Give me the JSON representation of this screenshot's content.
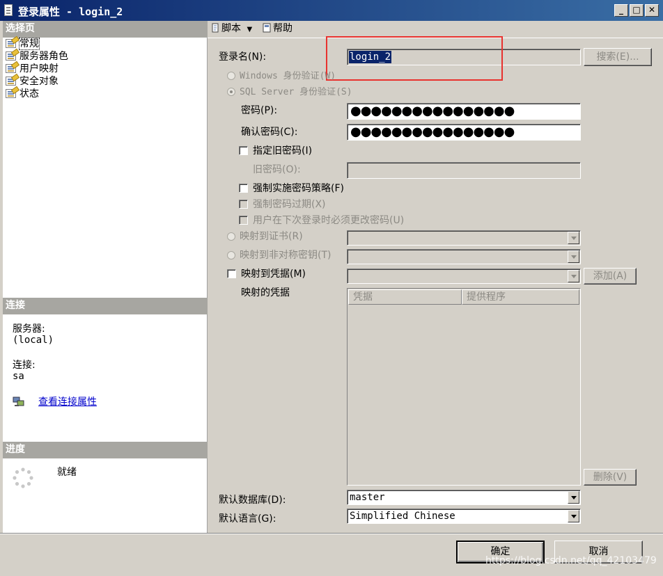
{
  "window": {
    "title": "登录属性 - login_2"
  },
  "left": {
    "section_select_page": "选择页",
    "nav_items": [
      {
        "label": "常规"
      },
      {
        "label": "服务器角色"
      },
      {
        "label": "用户映射"
      },
      {
        "label": "安全对象"
      },
      {
        "label": "状态"
      }
    ],
    "section_connection": "连接",
    "server_label": "服务器:",
    "server_value": "(local)",
    "connection_label": "连接:",
    "connection_value": "sa",
    "view_connection_link": "查看连接属性",
    "section_progress": "进度",
    "progress_status": "就绪"
  },
  "toolbar": {
    "script_label": "脚本",
    "help_label": "帮助"
  },
  "form": {
    "login_name_label": "登录名(N):",
    "login_name_value": "login_2",
    "search_button": "搜索(E)...",
    "windows_auth": "Windows 身份验证(W)",
    "sql_auth": "SQL Server 身份验证(S)",
    "password_label": "密码(P):",
    "password_mask": "●●●●●●●●●●●●●●●●",
    "confirm_label": "确认密码(C):",
    "confirm_mask": "●●●●●●●●●●●●●●●●",
    "specify_old_password": "指定旧密码(I)",
    "old_password_label": "旧密码(O):",
    "enforce_policy": "强制实施密码策略(F)",
    "enforce_expiration": "强制密码过期(X)",
    "must_change": "用户在下次登录时必须更改密码(U)",
    "map_certificate": "映射到证书(R)",
    "map_asym_key": "映射到非对称密钥(T)",
    "map_credential": "映射到凭据(M)",
    "add_button": "添加(A)",
    "mapped_credentials_label": "映射的凭据",
    "grid_col_credential": "凭据",
    "grid_col_provider": "提供程序",
    "remove_button": "删除(V)",
    "default_db_label": "默认数据库(D):",
    "default_db_value": "master",
    "default_lang_label": "默认语言(G):",
    "default_lang_value": "Simplified Chinese"
  },
  "footer": {
    "ok_button": "确定",
    "cancel_button": "取消"
  },
  "watermark": "https://blog.csdn.net/qq_42103479"
}
